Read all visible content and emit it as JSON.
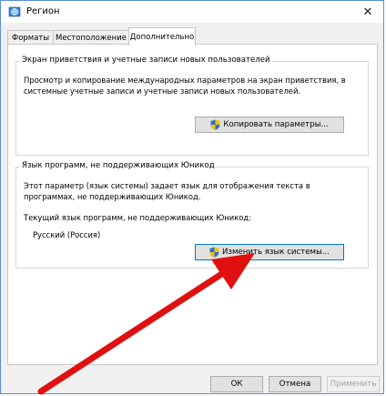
{
  "window": {
    "title": "Регион",
    "close_glyph": "✕"
  },
  "tabs": [
    {
      "label": "Форматы"
    },
    {
      "label": "Местоположение"
    },
    {
      "label": "Дополнительно",
      "active": true
    }
  ],
  "welcome_group": {
    "title": "Экран приветствия и учетные записи новых пользователей",
    "description": "Просмотр и копирование международных параметров на экран приветствия, в\nсистемные учетные записи и учетные записи новых пользователей.",
    "button_label": "Копировать параметры..."
  },
  "nonunicode_group": {
    "title": "Язык программ, не поддерживающих Юникод",
    "description": "Этот параметр (язык системы) задает язык для отображения текста в\nпрограммах, не поддерживающих Юникод.",
    "current_label": "Текущий язык программ, не поддерживающих Юникод:",
    "current_value": "Русский (Россия)",
    "button_label": "Изменить язык системы..."
  },
  "footer": {
    "ok_label": "ОК",
    "cancel_label": "Отмена",
    "apply_label": "Применить"
  },
  "colors": {
    "accent": "#0078d7",
    "arrow": "#e01010",
    "shield_blue": "#2f6fd1",
    "shield_yellow": "#f2c200"
  }
}
